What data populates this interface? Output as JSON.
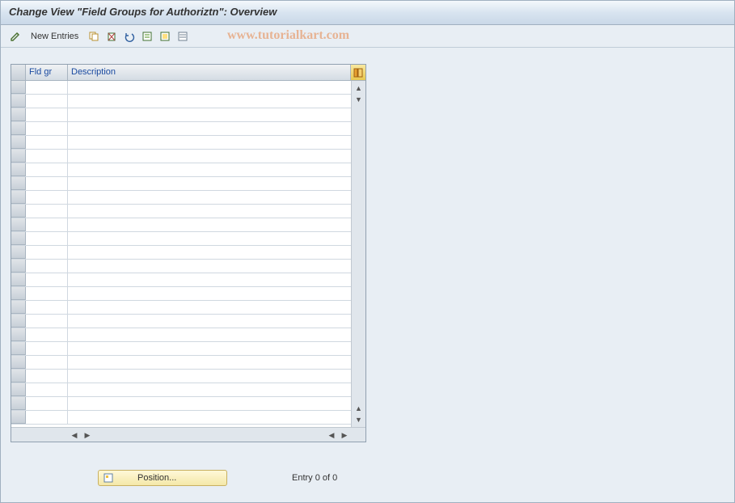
{
  "title": "Change View \"Field Groups for Authoriztn\": Overview",
  "toolbar": {
    "new_entries_label": "New Entries"
  },
  "watermark": "www.tutorialkart.com",
  "grid": {
    "columns": {
      "col1": "Fld gr",
      "col2": "Description"
    },
    "row_count": 25
  },
  "footer": {
    "position_label": "Position...",
    "entry_text": "Entry 0 of 0"
  }
}
